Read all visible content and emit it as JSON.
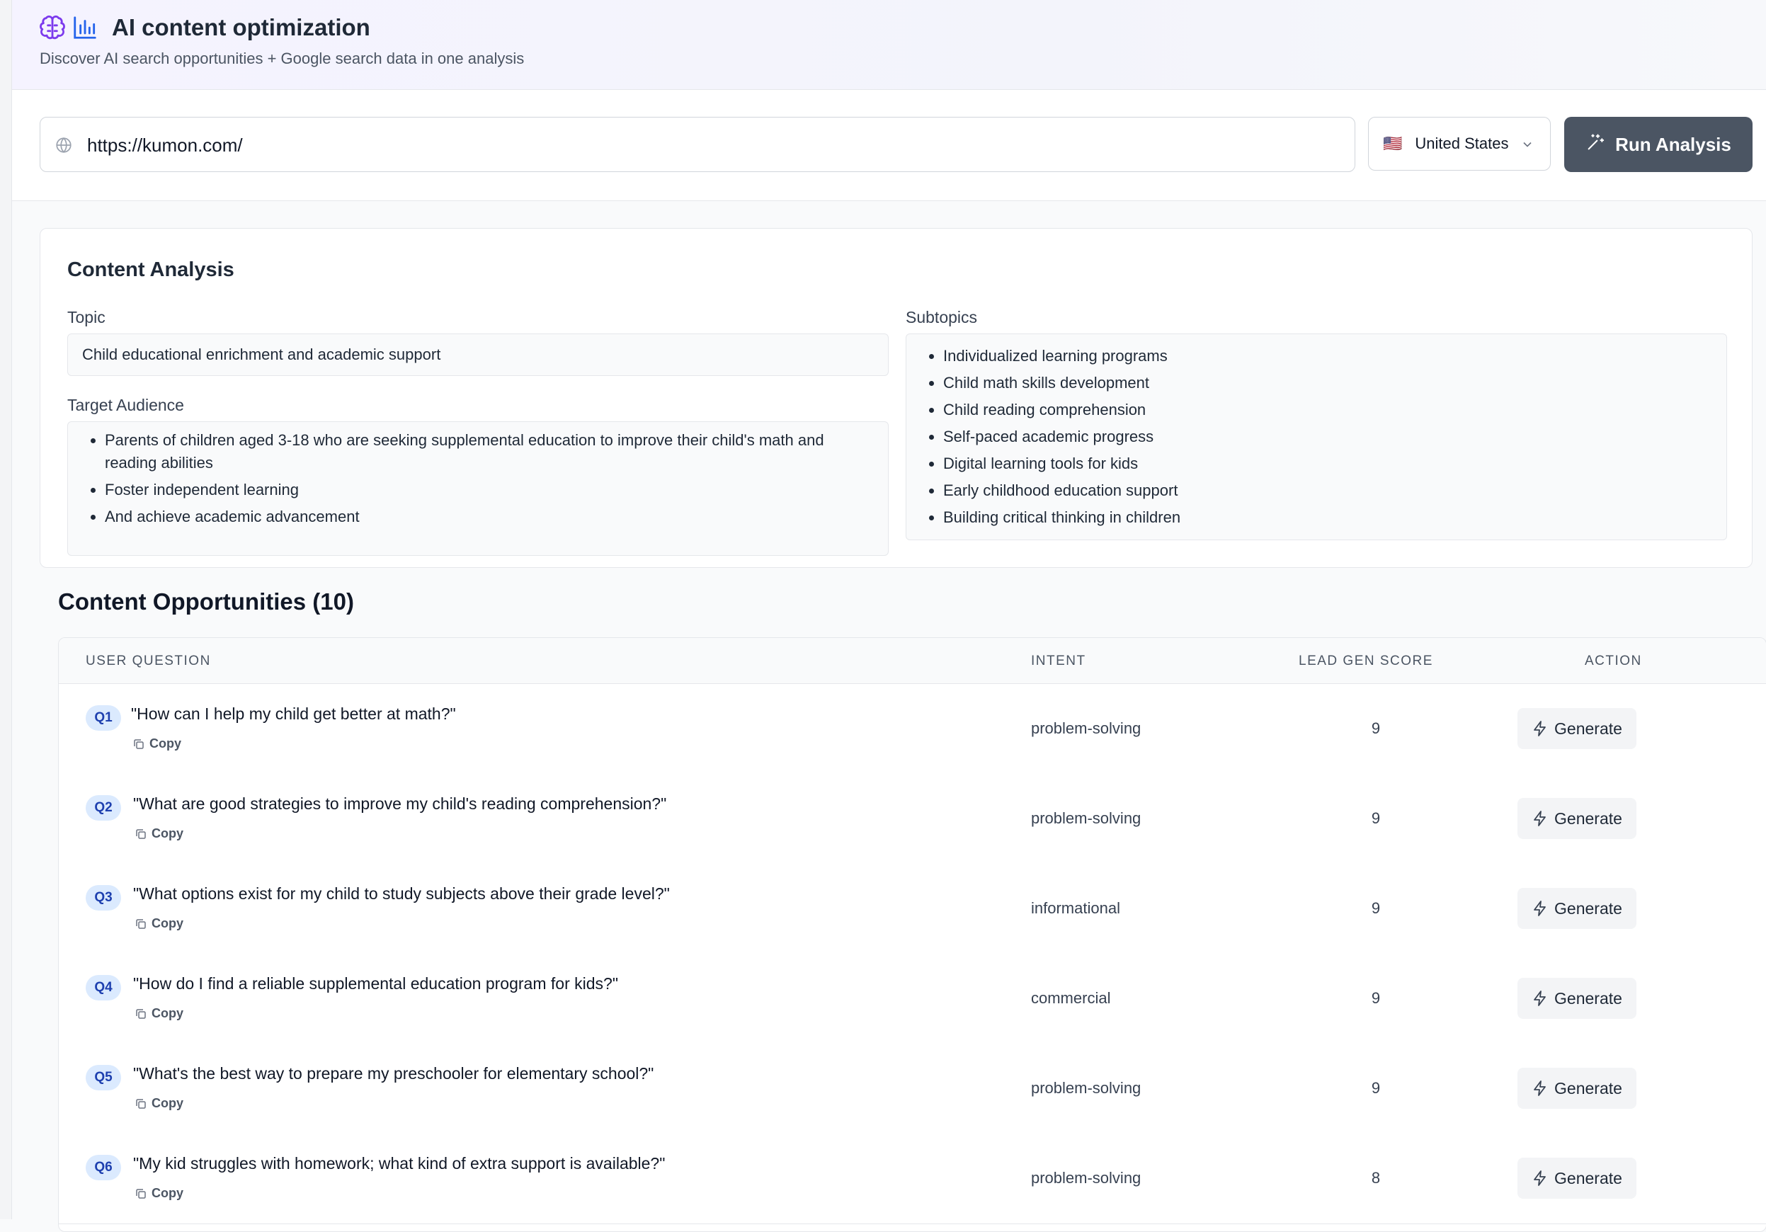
{
  "header": {
    "title": "AI content optimization",
    "subtitle": "Discover AI search opportunities + Google search data in one analysis",
    "icons": [
      "brain-icon",
      "bar-chart-icon"
    ]
  },
  "toolbar": {
    "url_value": "https://kumon.com/",
    "country": "United States",
    "country_flag": "🇺🇸",
    "run_label": "Run Analysis"
  },
  "content_analysis": {
    "title": "Content Analysis",
    "topic_label": "Topic",
    "topic": "Child educational enrichment and academic support",
    "audience_label": "Target Audience",
    "audience": [
      "Parents of children aged 3-18 who are seeking supplemental education to improve their child's math and reading abilities",
      "Foster independent learning",
      "And achieve academic advancement"
    ],
    "subtopics_label": "Subtopics",
    "subtopics": [
      "Individualized learning programs",
      "Child math skills development",
      "Child reading comprehension",
      "Self-paced academic progress",
      "Digital learning tools for kids",
      "Early childhood education support",
      "Building critical thinking in children"
    ]
  },
  "opportunities": {
    "title": "Content Opportunities (10)",
    "columns": [
      "USER QUESTION",
      "INTENT",
      "LEAD GEN SCORE",
      "ACTION"
    ],
    "copy_label": "Copy",
    "generate_label": "Generate",
    "rows": [
      {
        "id": "Q1",
        "question": "\"How can I help my child get better at math?\"",
        "intent": "problem-solving",
        "score": "9"
      },
      {
        "id": "Q2",
        "question": "\"What are good strategies to improve my child's reading comprehension?\"",
        "intent": "problem-solving",
        "score": "9"
      },
      {
        "id": "Q3",
        "question": "\"What options exist for my child to study subjects above their grade level?\"",
        "intent": "informational",
        "score": "9"
      },
      {
        "id": "Q4",
        "question": "\"How do I find a reliable supplemental education program for kids?\"",
        "intent": "commercial",
        "score": "9"
      },
      {
        "id": "Q5",
        "question": "\"What's the best way to prepare my preschooler for elementary school?\"",
        "intent": "problem-solving",
        "score": "9"
      },
      {
        "id": "Q6",
        "question": "\"My kid struggles with homework; what kind of extra support is available?\"",
        "intent": "problem-solving",
        "score": "8"
      }
    ]
  },
  "colors": {
    "accent_purple": "#7c3aed",
    "accent_blue": "#2563eb",
    "run_button": "#4b5563",
    "badge_bg": "#dbeafe",
    "badge_text": "#1e40af"
  }
}
